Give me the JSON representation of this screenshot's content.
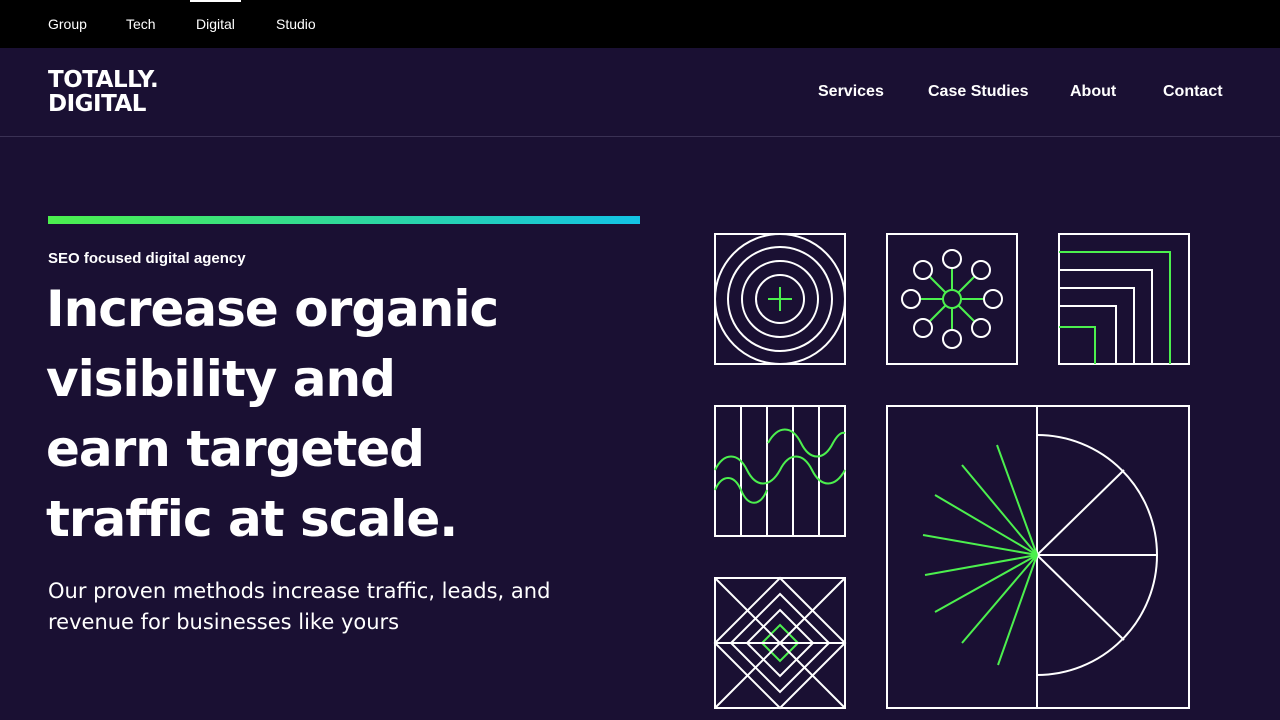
{
  "topbar": {
    "items": [
      {
        "label": "Group"
      },
      {
        "label": "Tech"
      },
      {
        "label": "Digital",
        "active": true
      },
      {
        "label": "Studio"
      }
    ]
  },
  "header": {
    "logo_line1": "TOTALLY.",
    "logo_line2": "DIGITAL",
    "nav": [
      {
        "label": "Services"
      },
      {
        "label": "Case Studies"
      },
      {
        "label": "About"
      },
      {
        "label": "Contact"
      }
    ]
  },
  "hero": {
    "eyebrow": "SEO focused digital agency",
    "headline_lines": [
      "Increase organic",
      "visibility and",
      "earn targeted",
      "traffic at scale."
    ],
    "subtext_lines": [
      "Our proven methods increase traffic, leads, and",
      "revenue for businesses like yours"
    ]
  },
  "colors": {
    "background": "#1a1033",
    "topbar": "#000000",
    "accent_green": "#4cf04e",
    "accent_cyan": "#13c3e6",
    "line_white": "#ffffff"
  },
  "illustration": {
    "tiles": [
      "concentric-circles-icon",
      "network-nodes-icon",
      "nested-corners-icon",
      "wave-lines-icon",
      "nested-diamonds-icon",
      "radial-burst-icon"
    ]
  }
}
